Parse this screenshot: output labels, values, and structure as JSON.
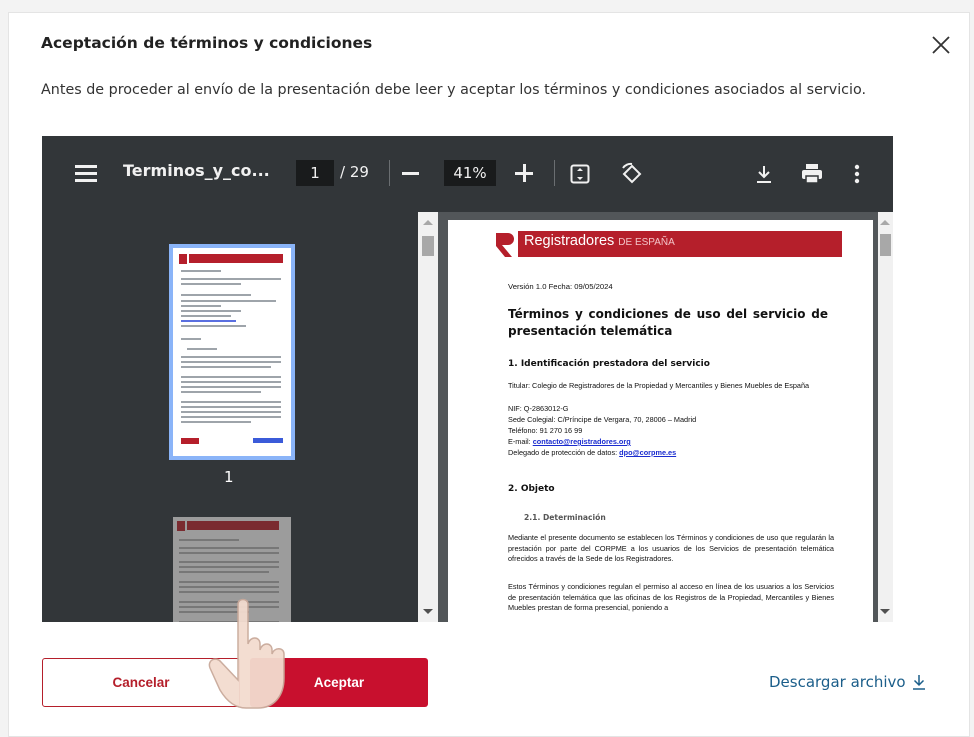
{
  "dialog": {
    "title": "Aceptación de términos y condiciones",
    "description": "Antes de proceder al envío de la presentación debe leer y aceptar los términos y condiciones asociados al servicio."
  },
  "viewer": {
    "filename": "Terminos_y_co...",
    "current_page": "1",
    "total_pages": "/ 29",
    "zoom": "41%",
    "thumbnail_label": "1"
  },
  "document": {
    "logo_main": "Registradores",
    "logo_sub": "DE ESPAÑA",
    "version": "Versión 1.0 Fecha: 09/05/2024",
    "title": "Términos y condiciones de uso del servicio de presentación telemática",
    "section1": "1. Identificación prestadora del servicio",
    "titular": "Titular: Colegio de Registradores de la Propiedad y Mercantiles y Bienes Muebles de España",
    "nif": "NIF: Q-2863012-G",
    "sede": "Sede Colegial:  C/Príncipe de Vergara, 70, 28006 – Madrid",
    "telefono": "Teléfono: 91 270 16 99",
    "email_label": "E-mail: ",
    "email": "contacto@registradores.org",
    "delegado_label": "Delegado de protección de datos: ",
    "delegado_email": "dpo@corpme.es",
    "section2": "2. Objeto",
    "section2_1": "2.1. Determinación",
    "para1": "Mediante el presente documento se establecen los Términos y condiciones de uso que regularán la prestación por parte del CORPME a los usuarios de los Servicios de presentación telemática ofrecidos a través de la Sede de los Registradores.",
    "para2": "Estos Términos y condiciones regulan el permiso al acceso en línea de los usuarios a los Servicios de presentación telemática que las oficinas de los Registros de la Propiedad, Mercantiles y Bienes Muebles prestan de forma presencial, poniendo a"
  },
  "actions": {
    "cancel": "Cancelar",
    "accept": "Aceptar",
    "download": "Descargar archivo"
  },
  "colors": {
    "brand_red": "#c8102e",
    "link_blue": "#1b5e8a"
  },
  "icons": [
    "close-icon",
    "menu-icon",
    "fit-page-icon",
    "rotate-icon",
    "download-icon",
    "print-icon",
    "more-options-icon",
    "download-arrow-icon",
    "pointer-hand-icon"
  ]
}
